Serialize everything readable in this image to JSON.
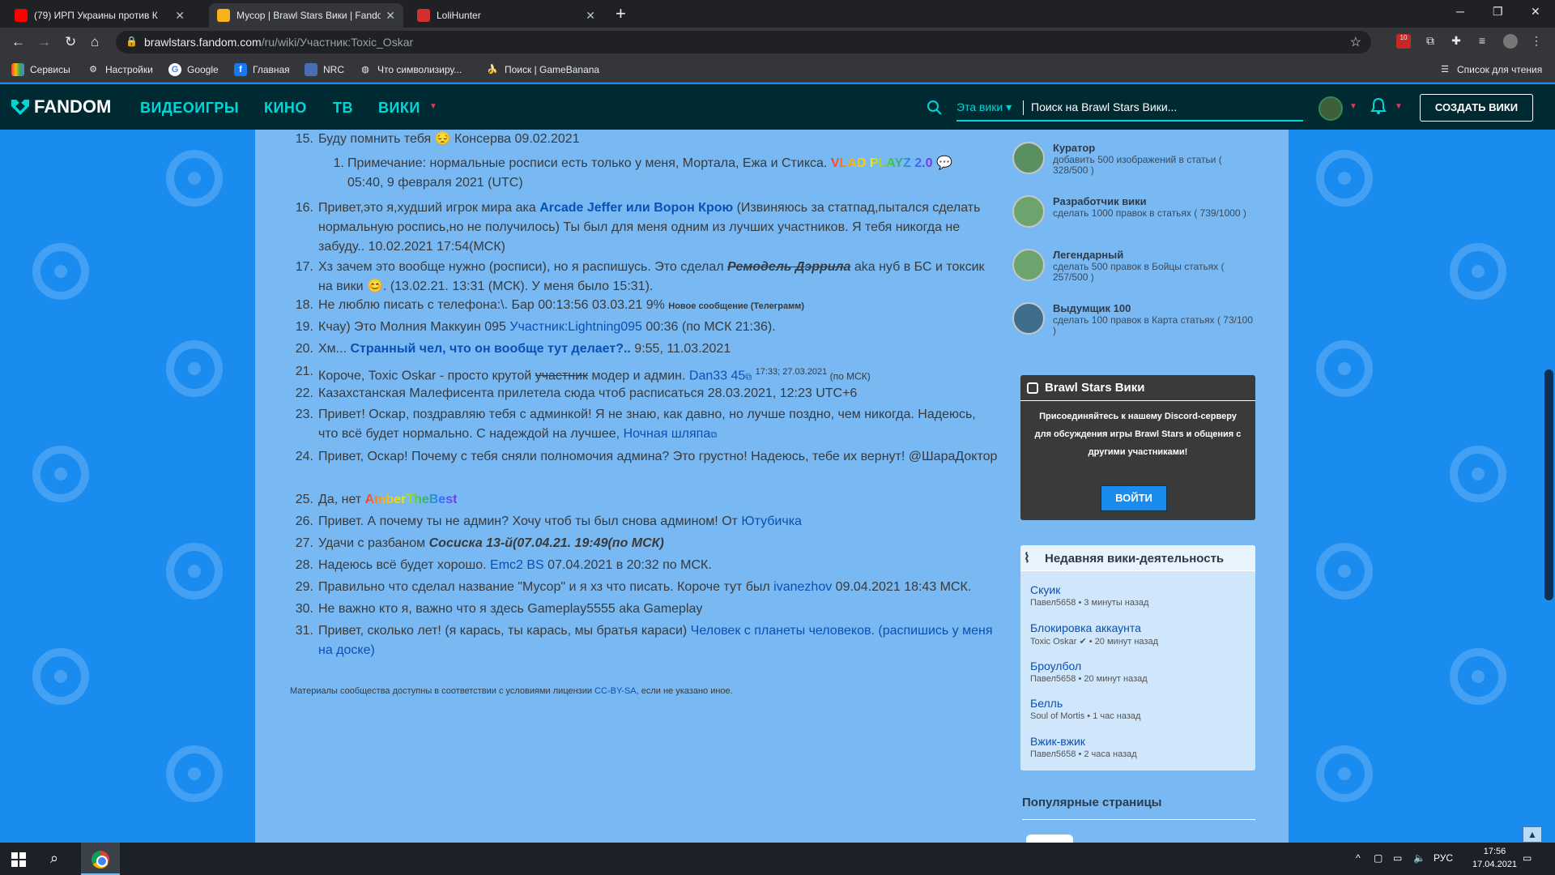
{
  "browser": {
    "tabs": [
      {
        "title": "(79) ИРП Украины против К"
      },
      {
        "title": "Мусор | Brawl Stars Вики | Fandom"
      },
      {
        "title": "LoliHunter"
      }
    ],
    "url_host": "brawlstars.fandom.com",
    "url_path": "/ru/wiki/Участник:Toxic_Oskar",
    "bookmarks": [
      "Сервисы",
      "Настройки",
      "Google",
      "Главная",
      "NRC",
      "Что символизиру...",
      "Поиск | GameBanana"
    ],
    "reading_list": "Список для чтения",
    "ext_badge": "10"
  },
  "fandom": {
    "logo": "FANDOM",
    "nav": [
      "ВИДЕОИГРЫ",
      "КИНО",
      "ТВ",
      "ВИКИ"
    ],
    "scope": "Эта вики",
    "search_placeholder": "Поиск на Brawl Stars Вики...",
    "create_button": "СОЗДАТЬ ВИКИ"
  },
  "entries": [
    {
      "n": "15.",
      "parts": [
        "Буду помнить тебя 😔 Консерва 09.02.2021"
      ]
    },
    {
      "n": "16.",
      "a": "Привет,это я,худший игрок мира ака ",
      "link": "Arcade Jeffer или Ворон Крою",
      "b": " (Извиняюсь за статпад,пытался сделать нормальную роспись,но не получилось) Ты был для меня одним из лучших участников. Я тебя никогда не забуду.. 10.02.2021 17:54(МСК)"
    },
    {
      "n": "17.",
      "a": "Хз зачем это вообще нужно (росписи), но я распишусь. Это сделал ",
      "link": "Ремодель Дэррила",
      "b": " aka нуб в БС и токсик на вики 😊. (13.02.21. 13:31 (МСК). У меня было 15:31)."
    },
    {
      "n": "18.",
      "a": "Не люблю писать с телефона:\\. Бар 00:13:56 03.03.21 9% ",
      "small": "Новое сообщение (Телеграмм)"
    },
    {
      "n": "19.",
      "a": "Кчау) Это Молния Маккуин 095 ",
      "link": "Участник:Lightning095",
      "b": " 00:36 (по МСК 21:36)."
    },
    {
      "n": "20.",
      "a": "Хм... ",
      "link": "Странный чел, что он вообще тут делает?..",
      "b": " 9:55, 11.03.2021"
    },
    {
      "n": "21.",
      "a": "Короче, Toxic Oskar - просто крутой ",
      "strike": "участник",
      "b": " модер и админ. ",
      "link": "Dan33 45",
      "small": "17:33; 27.03.2021",
      "c": " (по МСК)"
    },
    {
      "n": "22.",
      "a": "Казахстанская Малефисента прилетела сюда чтоб расписаться 28.03.2021, 12:23 UTC+6"
    },
    {
      "n": "23.",
      "a": "Привет! Оскар, поздравляю тебя с админкой! Я не знаю, как давно, но лучше поздно, чем никогда. Надеюсь, что всё будет нормально. С надеждой на лучшее, ",
      "link": "Ночная шляпа"
    },
    {
      "n": "24.",
      "a": "Привет, Оскар! Почему с тебя сняли полномочия админа? Это грустно! Надеюсь, тебе их вернут! @ШараДоктор"
    },
    {
      "n": "25.",
      "a": "Да, нет ",
      "rainbow": "AmberTheBest"
    },
    {
      "n": "26.",
      "a": "Привет. А почему ты не админ? Хочу чтоб ты был снова админом! От ",
      "link": "Ютубичка"
    },
    {
      "n": "27.",
      "a": "Удачи с разбаном ",
      "bi": "Сосиска 13-й(07.04.21. 19:49(по МСК)"
    },
    {
      "n": "28.",
      "a": "Надеюсь всё будет хорошо. ",
      "link": "Emc2 BS",
      "b": " 07.04.2021 в 20:32 по МСК."
    },
    {
      "n": "29.",
      "a": "Правильно что сделал название \"Мусор\" и я хз что писать. Короче тут был ",
      "link": "ivanezhov",
      "b": " 09.04.2021 18:43 МСК."
    },
    {
      "n": "30.",
      "a": "Не важно кто я, важно что я здесь Gameplay5555 aka Gameplay"
    },
    {
      "n": "31.",
      "a": "Привет, сколько лет! (я карась, ты карась, мы братья караси) ",
      "link": "Человек с планеты человеков. (распишись у меня на доске)"
    }
  ],
  "note": {
    "n": "1.",
    "a": "Примечание: нормальные росписи есть только у меня, Мортала, Ежа и Стикса. ",
    "rainbow": "VLAD PLAYZ 2.0",
    "b": " 05:40, 9 февраля 2021 (UTC)"
  },
  "license": {
    "a": "Материалы сообщества доступны в соответствии с условиями лицензии ",
    "link": "CC-BY-SA",
    "b": ", если не указано иное."
  },
  "badges": [
    {
      "title": "Куратор",
      "desc": "добавить 500 изображений в статьи ( 328/500 )"
    },
    {
      "title": "Разработчик вики",
      "desc": "сделать 1000 правок в статьях ( 739/1000 )"
    },
    {
      "title": "Легендарный",
      "desc": "сделать 500 правок в Бойцы статьях ( 257/500 )"
    },
    {
      "title": "Выдумщик 100",
      "desc": "сделать 100 правок в Карта статьях ( 73/100 )"
    }
  ],
  "discord": {
    "title": "Brawl Stars Вики",
    "text": "Присоединяйтесь к нашему Discord-серверу для обсуждения игры Brawl Stars и общения с другими участниками!",
    "button": "ВОЙТИ"
  },
  "activity": {
    "title": "Недавняя вики-деятельность",
    "items": [
      {
        "title": "Скуик",
        "meta": "Павел5658 • 3 минуты назад"
      },
      {
        "title": "Блокировка аккаунта",
        "meta": "Toxic Oskar ✔ • 20 минут назад"
      },
      {
        "title": "Броулбол",
        "meta": "Павел5658 • 20 минут назад"
      },
      {
        "title": "Белль",
        "meta": "Soul of Mortis • 1 час назад"
      },
      {
        "title": "Вжик-вжик",
        "meta": "Павел5658 • 2 часа назад"
      }
    ]
  },
  "popular": "Популярные страницы",
  "taskbar": {
    "lang": "РУС",
    "time": "17:56",
    "date": "17.04.2021"
  }
}
